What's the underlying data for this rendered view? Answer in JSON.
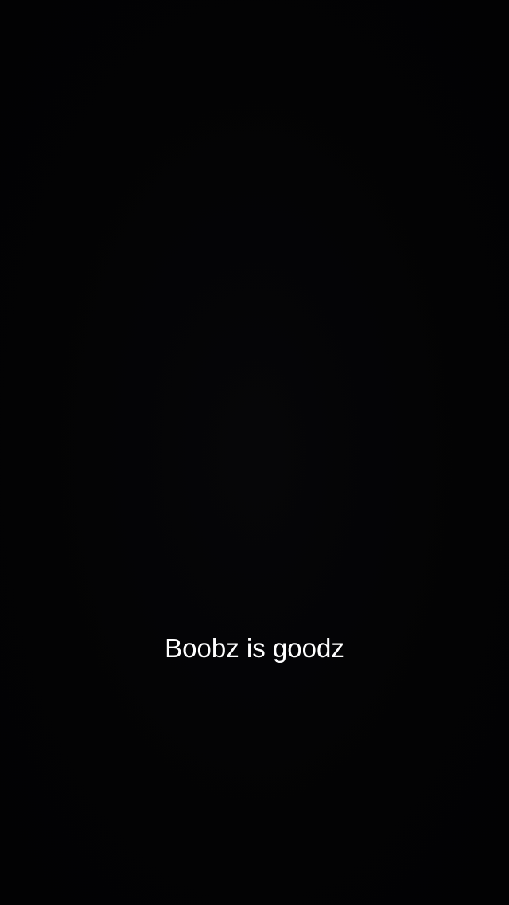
{
  "caption": {
    "text": "Boobz is goodz",
    "color": "#ffffff"
  },
  "background_color": "#030304"
}
